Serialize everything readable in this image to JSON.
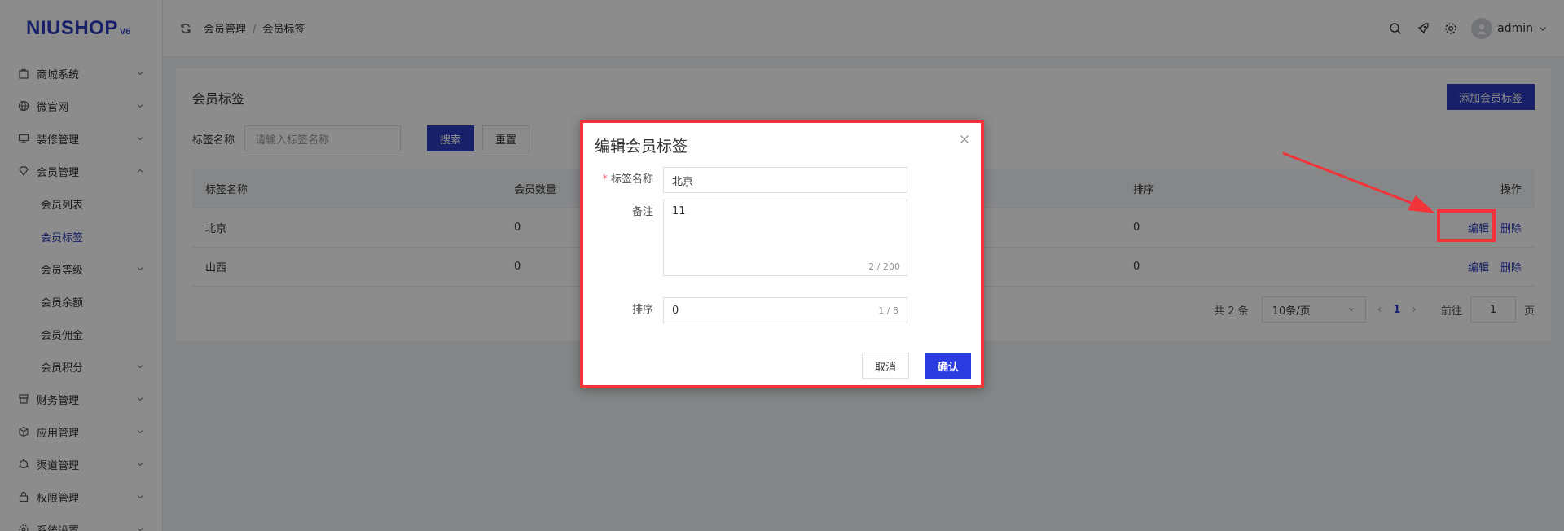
{
  "logo": {
    "main": "NIUSHOP",
    "version": "V6"
  },
  "sidebar": {
    "items": [
      {
        "label": "商城系统",
        "icon": "bag-icon"
      },
      {
        "label": "微官网",
        "icon": "globe-icon"
      },
      {
        "label": "装修管理",
        "icon": "brush-icon"
      },
      {
        "label": "会员管理",
        "icon": "diamond-icon",
        "expanded": true
      }
    ],
    "sub_items": [
      {
        "label": "会员列表"
      },
      {
        "label": "会员标签",
        "active": true
      },
      {
        "label": "会员等级",
        "has_children": true
      },
      {
        "label": "会员余额"
      },
      {
        "label": "会员佣金"
      },
      {
        "label": "会员积分",
        "has_children": true
      }
    ],
    "items_after": [
      {
        "label": "财务管理",
        "icon": "finance-icon"
      },
      {
        "label": "应用管理",
        "icon": "cube-icon"
      },
      {
        "label": "渠道管理",
        "icon": "channel-icon"
      },
      {
        "label": "权限管理",
        "icon": "lock-icon"
      },
      {
        "label": "系统设置",
        "icon": "gear-icon"
      }
    ]
  },
  "header": {
    "breadcrumb": [
      "会员管理",
      "会员标签"
    ],
    "user": "admin"
  },
  "page": {
    "title": "会员标签",
    "add_button": "添加会员标签",
    "filter_label": "标签名称",
    "filter_placeholder": "请输入标签名称",
    "search_button": "搜索",
    "reset_button": "重置"
  },
  "table": {
    "headers": [
      "标签名称",
      "会员数量",
      "排序",
      "操作"
    ],
    "rows": [
      {
        "name": "北京",
        "count": "0",
        "sort": "0"
      },
      {
        "name": "山西",
        "count": "0",
        "sort": "0"
      }
    ],
    "edit_label": "编辑",
    "delete_label": "删除"
  },
  "pagination": {
    "total": "共 2 条",
    "page_size": "10条/页",
    "current": "1",
    "goto_label": "前往",
    "goto_value": "1",
    "page_suffix": "页"
  },
  "dialog": {
    "title": "编辑会员标签",
    "name_label": "标签名称",
    "name_value": "北京",
    "remark_label": "备注",
    "remark_value": "11",
    "remark_count": "2 / 200",
    "sort_label": "排序",
    "sort_value": "0",
    "sort_count": "1 / 8",
    "cancel": "取消",
    "confirm": "确认"
  },
  "colors": {
    "primary": "#2b3bbd",
    "highlight": "#f0343a"
  }
}
